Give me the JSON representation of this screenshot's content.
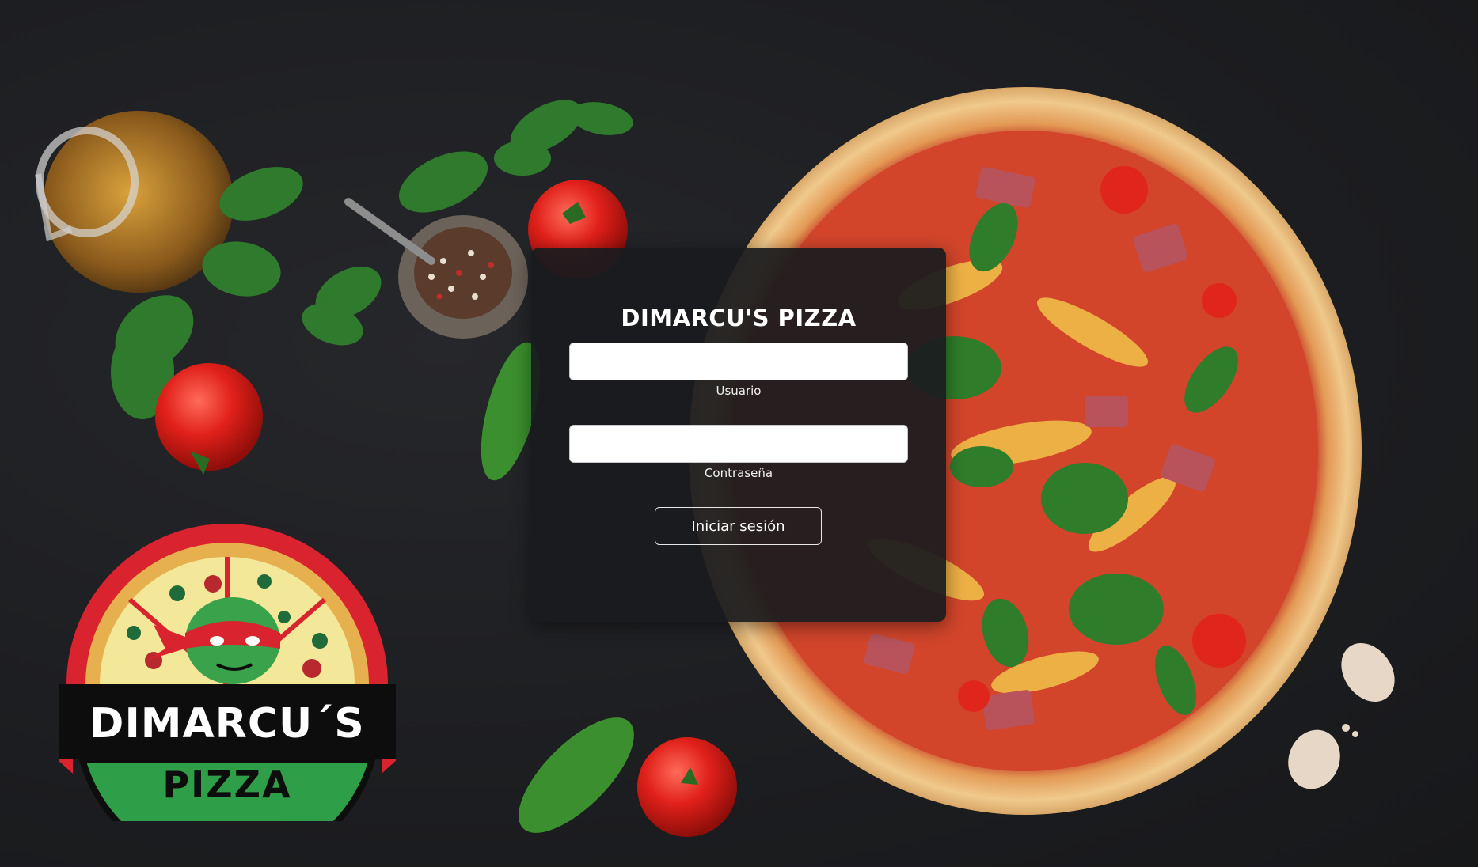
{
  "login": {
    "title": "DIMARCU'S PIZZA",
    "username": {
      "label": "Usuario",
      "value": "",
      "placeholder": ""
    },
    "password": {
      "label": "Contraseña",
      "value": "",
      "placeholder": ""
    },
    "submit_label": "Iniciar sesión"
  },
  "logo": {
    "word1": "DIMARCU´S",
    "word2": "PIZZA"
  },
  "colors": {
    "background": "#1e1f22",
    "card": "#1a1b1e",
    "logo_red": "#d9232e",
    "logo_green": "#2e9e48",
    "logo_yellow": "#f3e79a"
  },
  "decor": {
    "images": [
      "pizza-image",
      "olive-oil-jug-image",
      "pepper-bowl-image",
      "arugula-image",
      "tomato-image",
      "basil-leaf-image",
      "garlic-image"
    ]
  }
}
